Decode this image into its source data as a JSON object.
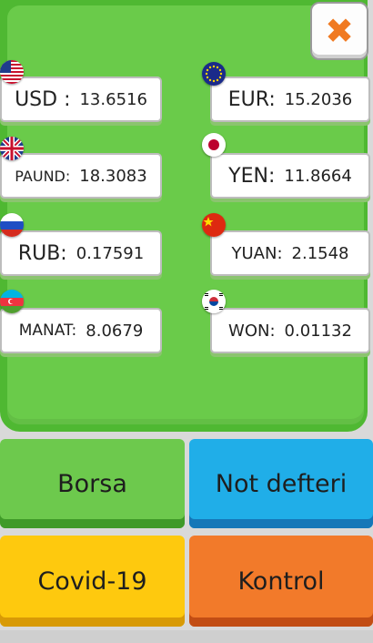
{
  "close_icon_glyph": "✖",
  "rates": {
    "usd": {
      "code": "USD :",
      "value": "13.6516"
    },
    "eur": {
      "code": "EUR:",
      "value": "15.2036"
    },
    "gbp": {
      "code": "PAUND:",
      "value": "18.3083"
    },
    "jpy": {
      "code": "YEN:",
      "value": "11.8664"
    },
    "rub": {
      "code": "RUB:",
      "value": "0.17591"
    },
    "cny": {
      "code": "YUAN:",
      "value": "2.1548"
    },
    "azn": {
      "code": "MANAT:",
      "value": "8.0679"
    },
    "krw": {
      "code": "WON:",
      "value": "0.01132"
    }
  },
  "buttons": {
    "borsa": "Borsa",
    "not_defteri": "Not defteri",
    "covid": "Covid-19",
    "kontrol": "Kontrol"
  },
  "colors": {
    "panel": "#6acb4a",
    "borsa": "#6dc94d",
    "not_defteri": "#20aee8",
    "covid": "#fec90e",
    "kontrol": "#f27a2a",
    "close_x": "#f07a22"
  },
  "flags": [
    "us-flag-icon",
    "eu-flag-icon",
    "uk-flag-icon",
    "japan-flag-icon",
    "russia-flag-icon",
    "china-flag-icon",
    "azerbaijan-flag-icon",
    "south-korea-flag-icon"
  ]
}
